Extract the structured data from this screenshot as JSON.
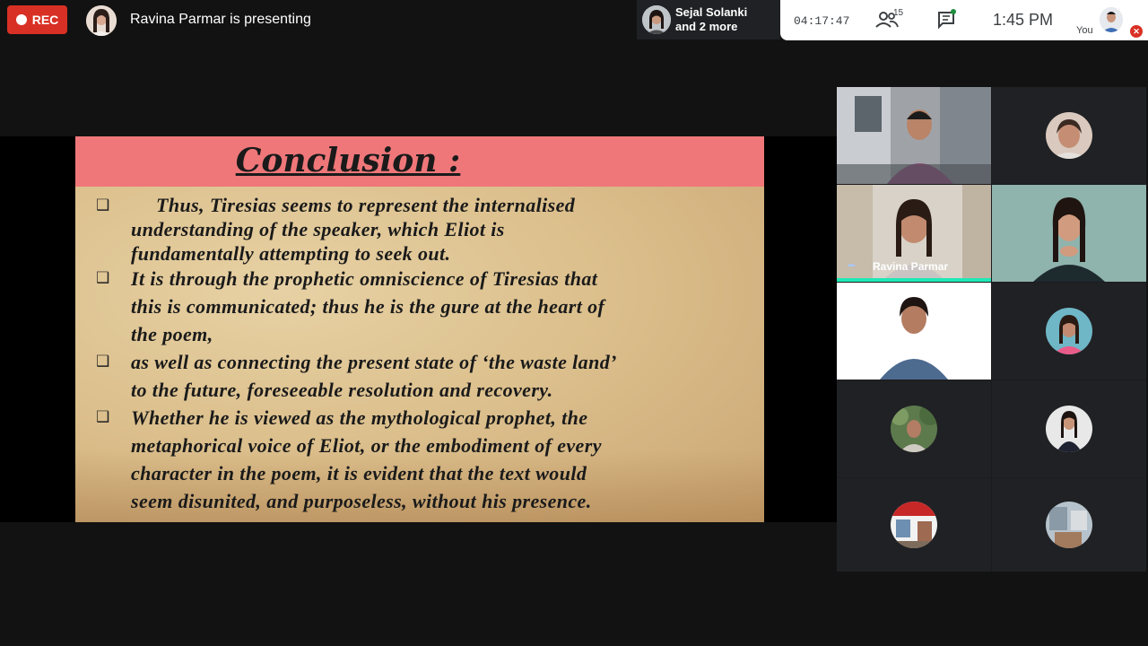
{
  "topbar": {
    "rec_label": "REC",
    "presenting_text": "Ravina Parmar is presenting",
    "viewers_line1": "Sejal Solanki",
    "viewers_line2": "and 2 more",
    "timer": "04:17:47",
    "people_count": "15",
    "clock": "1:45 PM",
    "self_label": "You"
  },
  "slide": {
    "title": "Conclusion :",
    "bullet_glyph": "❑",
    "lines": [
      "Thus, Tiresias seems to represent the internalised",
      "understanding of the speaker, which Eliot is",
      "fundamentally attempting to seek out.",
      "It is through the prophetic omniscience of Tiresias that",
      "this is communicated; thus he is the gure at the heart of",
      "the poem,",
      "as well as connecting the present state of ‘the waste land’",
      "to the future, foreseeable resolution and recovery.",
      "Whether he is viewed as the mythological prophet, the",
      "metaphorical voice of Eliot, or the embodiment of every",
      "character in the poem, it is evident that the text would",
      "seem disunited, and purposeless, without his presence."
    ]
  },
  "participants": {
    "speaker_name": "Ravina Parmar"
  },
  "colors": {
    "rec_red": "#d93025",
    "slide_header": "#ef7779",
    "speaking_accent": "#1de9b6"
  }
}
